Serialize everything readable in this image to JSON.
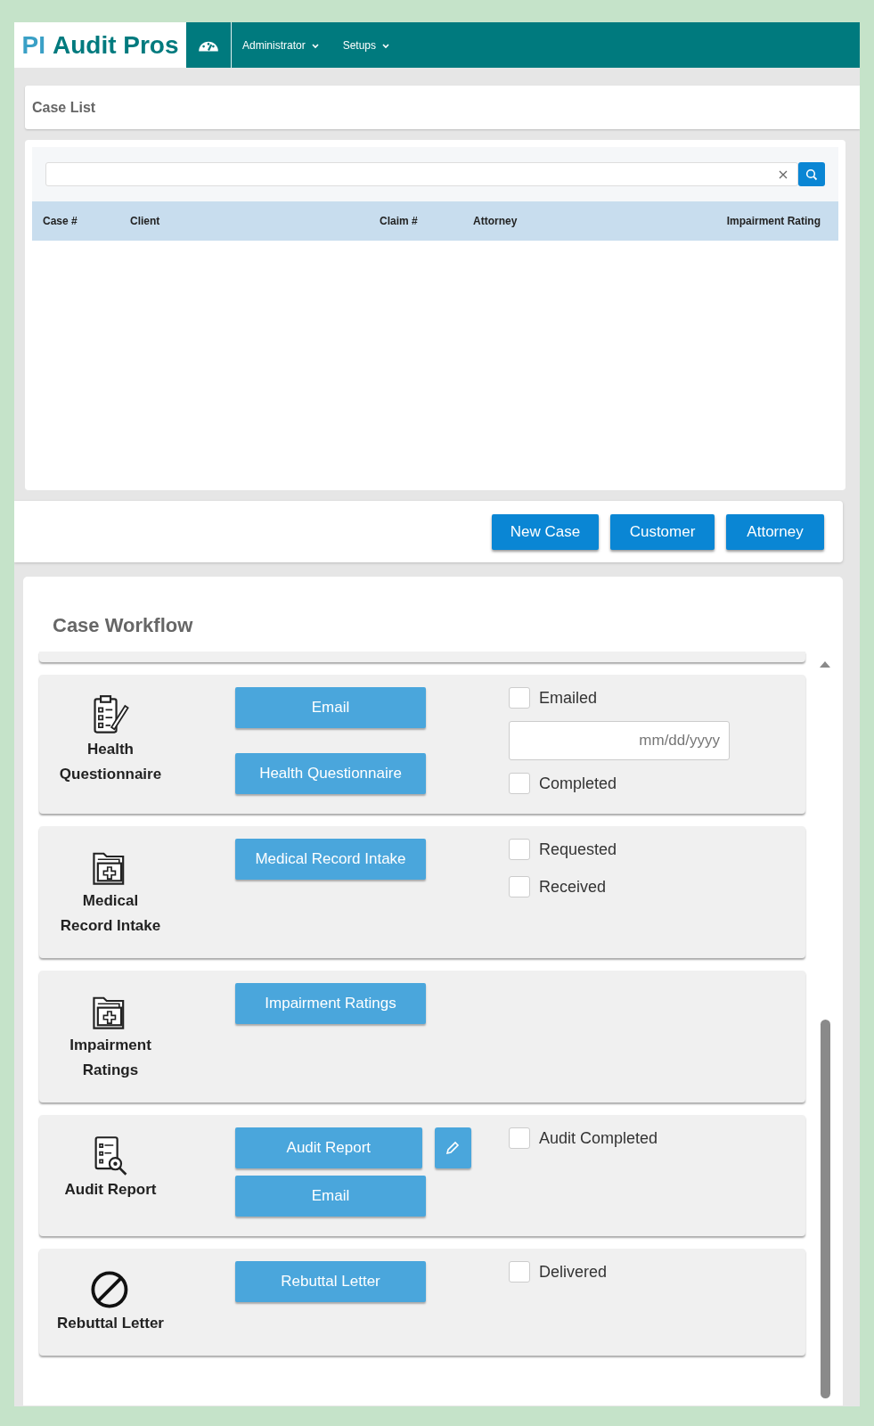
{
  "header": {
    "logo": {
      "prefix": "PI",
      "name": "Audit Pros"
    },
    "menus": [
      {
        "label": "Administrator"
      },
      {
        "label": "Setups"
      }
    ]
  },
  "case_list": {
    "title": "Case List",
    "columns": [
      "Case #",
      "Client",
      "Claim #",
      "Attorney",
      "Impairment Rating"
    ],
    "buttons": [
      "New Case",
      "Customer",
      "Attorney"
    ]
  },
  "workflow": {
    "title": "Case Workflow",
    "steps": [
      {
        "label": "Health Questionnaire",
        "buttons": [
          {
            "kind": "wide",
            "label": "Email"
          },
          {
            "kind": "wide",
            "label": "Health Questionnaire"
          }
        ],
        "checks": [
          {
            "kind": "checkbox",
            "label": "Emailed",
            "checked": false
          },
          {
            "kind": "date",
            "placeholder": "mm/dd/yyyy"
          },
          {
            "kind": "checkbox",
            "label": "Completed",
            "checked": false
          }
        ]
      },
      {
        "label": "Medical Record Intake",
        "buttons": [
          {
            "kind": "wide",
            "label": "Medical Record Intake"
          }
        ],
        "checks": [
          {
            "kind": "checkbox",
            "label": "Requested",
            "checked": false
          },
          {
            "kind": "checkbox",
            "label": "Received",
            "checked": false
          }
        ]
      },
      {
        "label": "Impairment Ratings",
        "buttons": [
          {
            "kind": "wide",
            "label": "Impairment Ratings"
          }
        ]
      },
      {
        "label": "Audit Report",
        "buttons": [
          {
            "kind": "wide",
            "label": "Audit Report"
          },
          {
            "kind": "edit"
          },
          {
            "kind": "wide",
            "label": "Email"
          }
        ],
        "checks": [
          {
            "kind": "checkbox",
            "label": "Audit Completed",
            "checked": false
          }
        ]
      },
      {
        "label": "Rebuttal Letter",
        "buttons": [
          {
            "kind": "wide",
            "label": "Rebuttal Letter"
          }
        ],
        "checks": [
          {
            "kind": "checkbox",
            "label": "Delivered",
            "checked": false
          }
        ]
      }
    ]
  }
}
